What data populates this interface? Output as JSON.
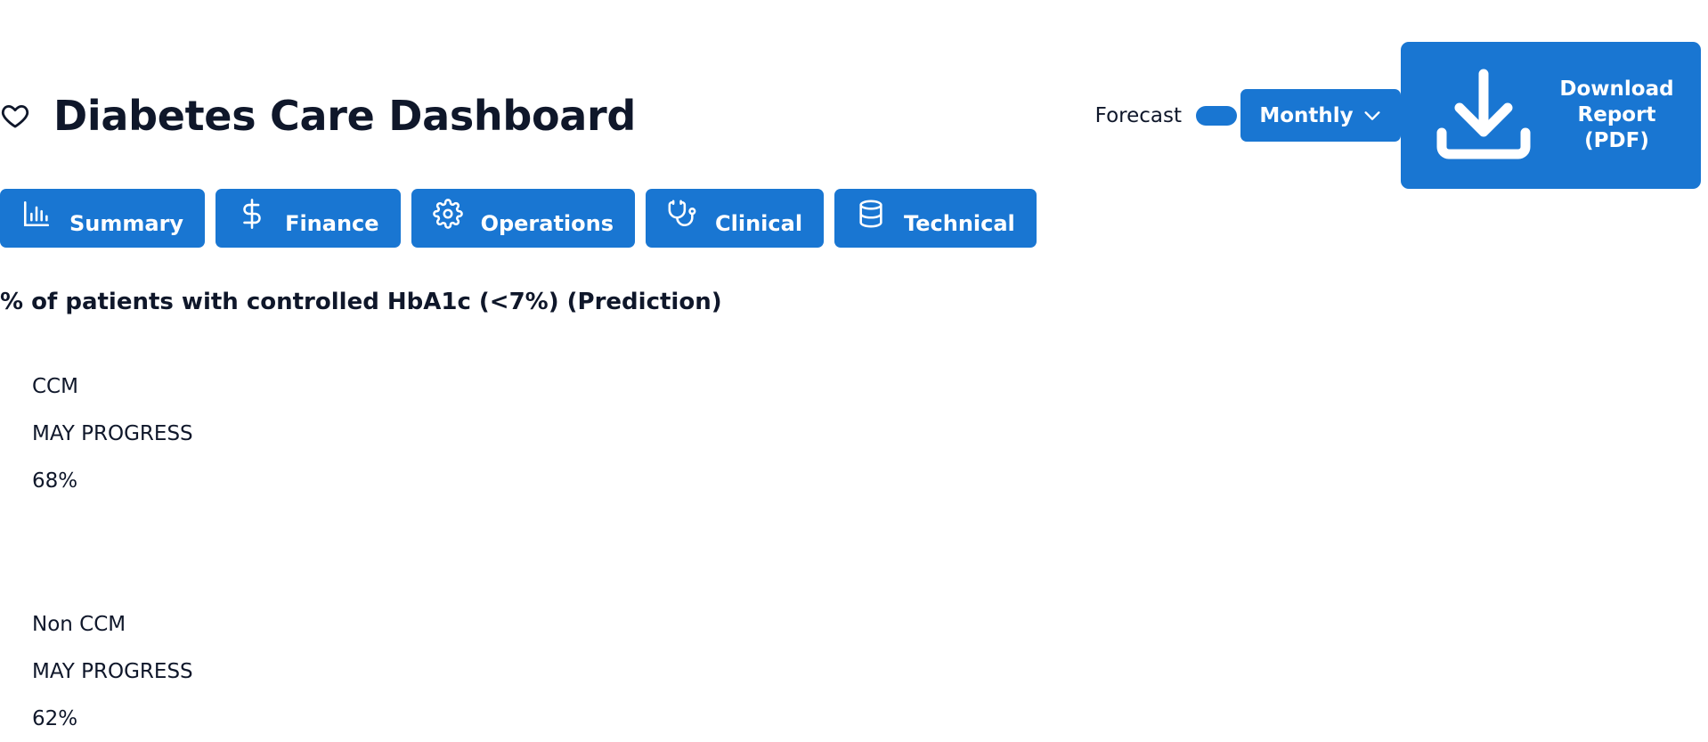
{
  "header": {
    "title": "Diabetes Care Dashboard",
    "icon": "heart-icon"
  },
  "controls": {
    "forecast_label": "Forecast",
    "forecast_toggle_on": true,
    "period_select": {
      "selected": "Monthly",
      "icon": "chevron-down-icon"
    },
    "download_button": {
      "label": "Download\nReport\n(PDF)",
      "icon": "download-icon"
    }
  },
  "tabs": [
    {
      "label": "Summary",
      "icon": "bar-chart-icon"
    },
    {
      "label": "Finance",
      "icon": "dollar-icon"
    },
    {
      "label": "Operations",
      "icon": "gear-icon"
    },
    {
      "label": "Clinical",
      "icon": "stethoscope-icon"
    },
    {
      "label": "Technical",
      "icon": "database-icon"
    }
  ],
  "section": {
    "title": "% of patients with controlled HbA1c (<7%) (Prediction)",
    "groups": [
      {
        "name": "CCM",
        "period": "MAY PROGRESS",
        "value": "68%"
      },
      {
        "name": "Non CCM",
        "period": "MAY PROGRESS",
        "value": "62%"
      }
    ]
  },
  "colors": {
    "accent": "#1976d2",
    "text": "#0f172a",
    "background": "#ffffff"
  }
}
